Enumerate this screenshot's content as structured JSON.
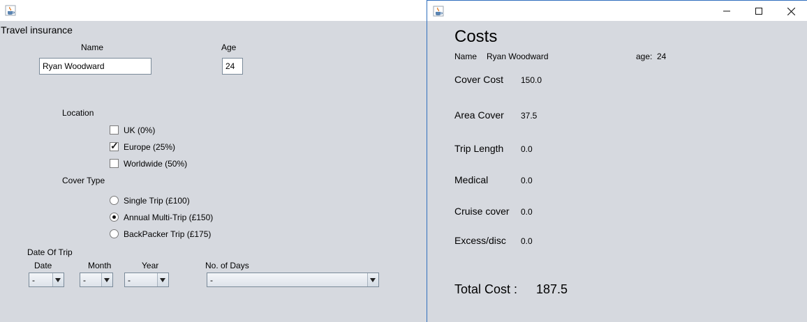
{
  "left_window": {
    "heading": "Travel insurance",
    "name_label": "Name",
    "name_value": "Ryan Woodward",
    "age_label": "Age",
    "age_value": "24",
    "location_label": "Location",
    "locations": [
      {
        "label": "UK (0%)",
        "checked": false
      },
      {
        "label": "Europe (25%)",
        "checked": true
      },
      {
        "label": "Worldwide (50%)",
        "checked": false
      }
    ],
    "cover_type_label": "Cover Type",
    "cover_types": [
      {
        "label": "Single Trip (£100)",
        "selected": false
      },
      {
        "label": "Annual Multi-Trip (£150)",
        "selected": true
      },
      {
        "label": "BackPacker Trip (£175)",
        "selected": false
      }
    ],
    "date_of_trip_label": "Date Of Trip",
    "date_label": "Date",
    "month_label": "Month",
    "year_label": "Year",
    "days_label": "No. of Days",
    "date_value": "-",
    "month_value": "-",
    "year_value": "-",
    "days_value": "-"
  },
  "right_window": {
    "heading": "Costs",
    "name_label": "Name",
    "name_value": "Ryan Woodward",
    "age_label": "age:",
    "age_value": "24",
    "rows": [
      {
        "label": "Cover Cost",
        "value": "150.0"
      },
      {
        "label": "Area Cover",
        "value": "37.5"
      },
      {
        "label": "Trip Length",
        "value": "0.0"
      },
      {
        "label": "Medical",
        "value": "0.0"
      },
      {
        "label": "Cruise cover",
        "value": "0.0"
      },
      {
        "label": "Excess/disc",
        "value": "0.0"
      }
    ],
    "total_label": "Total Cost :",
    "total_value": "187.5"
  },
  "icons": {
    "app": "java-cup-icon",
    "minimize": "minimize-icon",
    "maximize": "maximize-icon",
    "close": "close-icon"
  },
  "colors": {
    "window_bg": "#d6d9df",
    "titlebar_bg": "#ffffff",
    "active_border": "#2f6ebd"
  }
}
